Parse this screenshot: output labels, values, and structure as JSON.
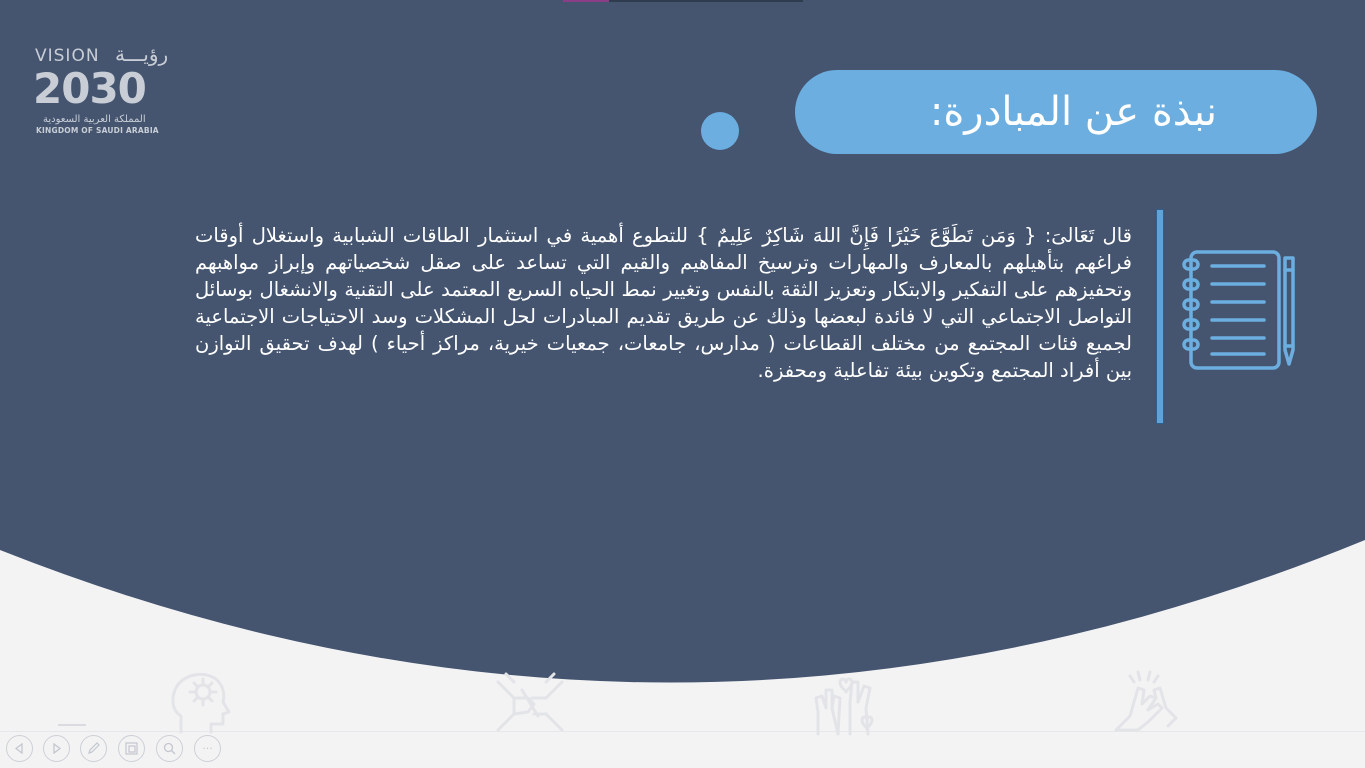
{
  "slide": {
    "title": "نبذة عن المبادرة:",
    "body": "قال تَعَالىَ: { وَمَن تَطَوَّعَ خَيْرًا فَإِنَّ اللهَ شَاكِرٌ عَلِيمٌ } للتطوع أهمية في استثمار الطاقات الشبابية واستغلال أوقات فراغهم بتأهيلهم بالمعارف والمهارات وترسيخ المفاهيم والقيم التي تساعد على صقل شخصياتهم وإبراز مواهبهم وتحفيزهم على التفكير والابتكار وتعزيز الثقة بالنفس وتغيير نمط الحياه السريع المعتمد على التقنية والانشغال بوسائل التواصل الاجتماعي التي لا فائدة لبعضها وذلك عن طريق تقديم المبادرات لحل المشكلات وسد الاحتياجات الاجتماعية لجميع فئات المجتمع من مختلف القطاعات ( مدارس، جامعات، جمعيات خيرية، مراكز أحياء ) لهدف تحقيق التوازن بين أفراد المجتمع وتكوين بيئة تفاعلية ومحفزة."
  },
  "logo": {
    "vision": "VISION",
    "brand_ar": "رؤيـــة",
    "year": "2030",
    "kingdom_ar": "المملكة العربية السعودية",
    "kingdom_en": "KINGDOM OF SAUDI ARABIA"
  },
  "icons": {
    "side": "notebook-icon",
    "footer": [
      "hands-clap-icon",
      "hands-heart-icon",
      "team-hands-icon",
      "head-gear-icon"
    ]
  },
  "nav": {
    "buttons": [
      "previous-slide",
      "next-slide",
      "pen",
      "slide-sorter",
      "zoom",
      "more-options"
    ],
    "more_label": "···"
  },
  "colors": {
    "dark": "#455570",
    "accent": "#6caee0",
    "background": "#f3f3f4",
    "text": "#ffffff"
  }
}
